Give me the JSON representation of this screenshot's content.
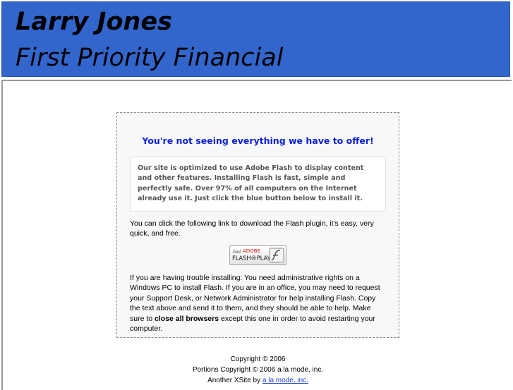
{
  "header": {
    "name": "Larry Jones",
    "company": "First Priority Financial"
  },
  "notice": {
    "title": "You're not seeing everything we have to offer!",
    "info": "Our site is optimized to use Adobe Flash to display content and other features. Installing Flash is fast, simple and perfectly safe. Over 97% of all computers on the Internet already use it. Just click the blue button below to install it.",
    "download_text": "You can click the following link to download the Flash plugin, it's easy, very quick, and free.",
    "flash_button": {
      "get": "Get",
      "adobe": "ADOBE",
      "player": "FLASH®PLAYER"
    },
    "trouble_text_start": "If you are having trouble installing: You need administrative rights on a Windows PC to install Flash. If you are in an office, you may need to request your Support Desk, or Network Administrator for help installing Flash. Copy the text above and send it to them, and they should be able to help. Make sure to ",
    "trouble_text_bold": "close all browsers",
    "trouble_text_end": " except this one in order to avoid restarting your computer."
  },
  "footer": {
    "copyright": "Copyright © 2006",
    "portions": "Portions Copyright © 2006 a la mode, inc.",
    "xsite_prefix": "Another XSite by ",
    "xsite_link": "a la mode, inc."
  }
}
